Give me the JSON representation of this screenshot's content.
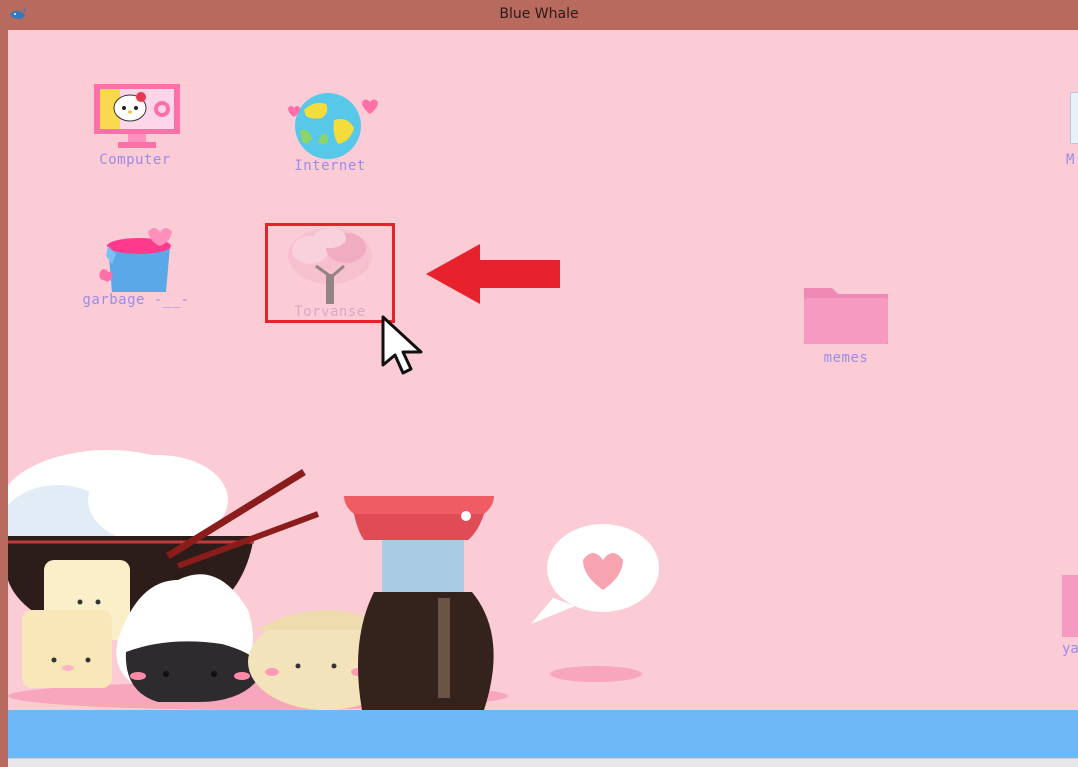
{
  "window": {
    "title": "Blue Whale"
  },
  "desktop": {
    "icons": [
      {
        "id": "computer",
        "label": "Computer"
      },
      {
        "id": "internet",
        "label": "Internet"
      },
      {
        "id": "garbage",
        "label": "garbage -__-"
      },
      {
        "id": "torvanse",
        "label": "Torvanse"
      },
      {
        "id": "memes",
        "label": "memes"
      },
      {
        "id": "partial-top-right",
        "label": "M"
      },
      {
        "id": "partial-bottom-right",
        "label": "ya"
      }
    ]
  },
  "colors": {
    "desktop_bg": "#fcccd6",
    "title_bar": "#b86a5e",
    "taskbar": "#6fb8f7",
    "icon_label": "#9b8ce8",
    "highlight": "#e3242b"
  }
}
